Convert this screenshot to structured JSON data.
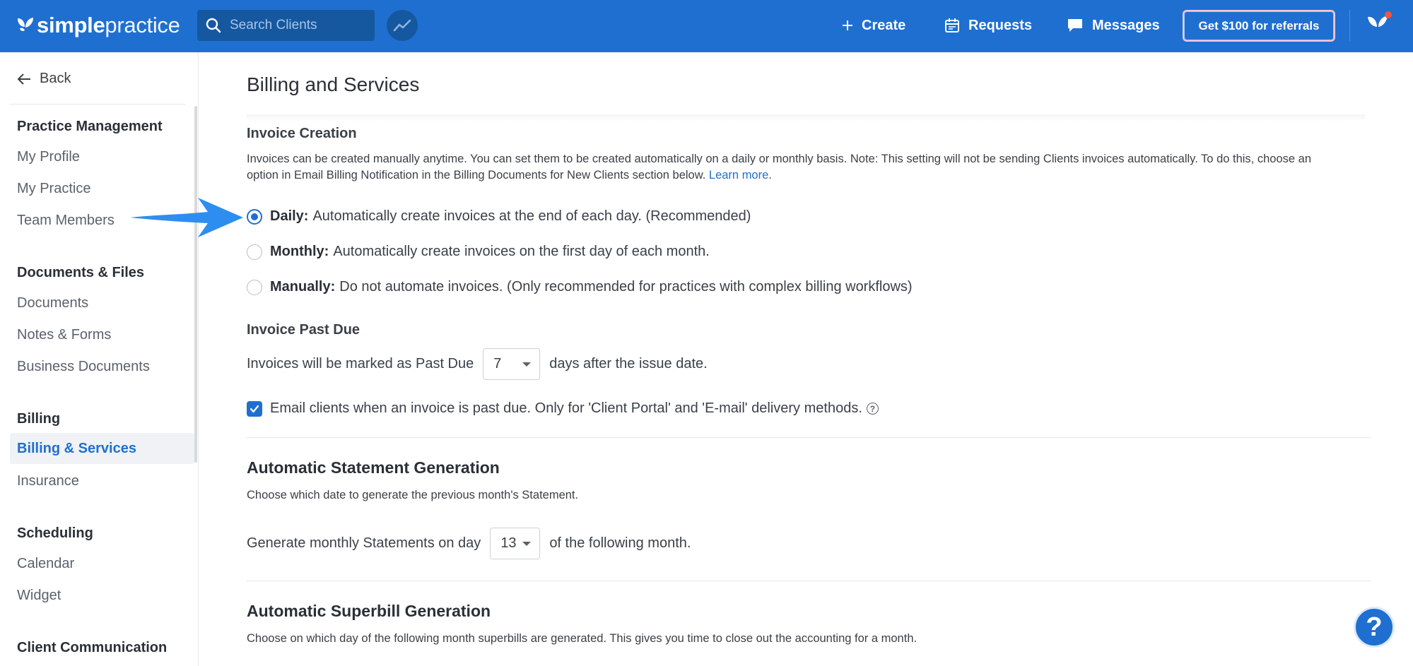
{
  "brand": {
    "bold": "simple",
    "light": "practice"
  },
  "header": {
    "search_placeholder": "Search Clients",
    "create_label": "Create",
    "requests_label": "Requests",
    "messages_label": "Messages",
    "referral_label": "Get $100 for referrals"
  },
  "sidebar": {
    "back_label": "Back",
    "groups": [
      {
        "title": "Practice Management",
        "items": [
          "My Profile",
          "My Practice",
          "Team Members"
        ]
      },
      {
        "title": "Documents & Files",
        "items": [
          "Documents",
          "Notes & Forms",
          "Business Documents"
        ]
      },
      {
        "title": "Billing",
        "items": [
          "Billing & Services",
          "Insurance"
        ]
      },
      {
        "title": "Scheduling",
        "items": [
          "Calendar",
          "Widget"
        ]
      },
      {
        "title": "Client Communication",
        "items": []
      }
    ],
    "active_item": "Billing & Services"
  },
  "main": {
    "title": "Billing and Services",
    "invoice_creation": {
      "label": "Invoice Creation",
      "description": "Invoices can be created manually anytime. You can set them to be created automatically on a daily or monthly basis. Note: This setting will not be sending Clients invoices automatically. To do this, choose an option in Email Billing Notification in the Billing Documents for New Clients section below.",
      "learn_more": "Learn more",
      "options": [
        {
          "title": "Daily:",
          "text": "Automatically create invoices at the end of each day. (Recommended)",
          "selected": true
        },
        {
          "title": "Monthly:",
          "text": "Automatically create invoices on the first day of each month.",
          "selected": false
        },
        {
          "title": "Manually:",
          "text": "Do not automate invoices. (Only recommended for practices with complex billing workflows)",
          "selected": false
        }
      ]
    },
    "invoice_past_due": {
      "label": "Invoice Past Due",
      "prefix": "Invoices will be marked as Past Due",
      "days_value": "7",
      "suffix": "days after the issue date.",
      "email_checkbox_label": "Email clients when an invoice is past due. Only for 'Client Portal' and 'E-mail' delivery methods.",
      "email_checked": true
    },
    "statement_generation": {
      "heading": "Automatic Statement Generation",
      "description": "Choose which date to generate the previous month's Statement.",
      "prefix": "Generate monthly Statements on day",
      "day_value": "13",
      "suffix": "of the following month."
    },
    "superbill_generation": {
      "heading": "Automatic Superbill Generation",
      "description": "Choose on which day of the following month superbills are generated. This gives you time to close out the accounting for a month."
    }
  },
  "help_label": "?",
  "colors": {
    "brand_blue": "#1f6fd1",
    "arrow_blue": "#2d8ef0"
  }
}
